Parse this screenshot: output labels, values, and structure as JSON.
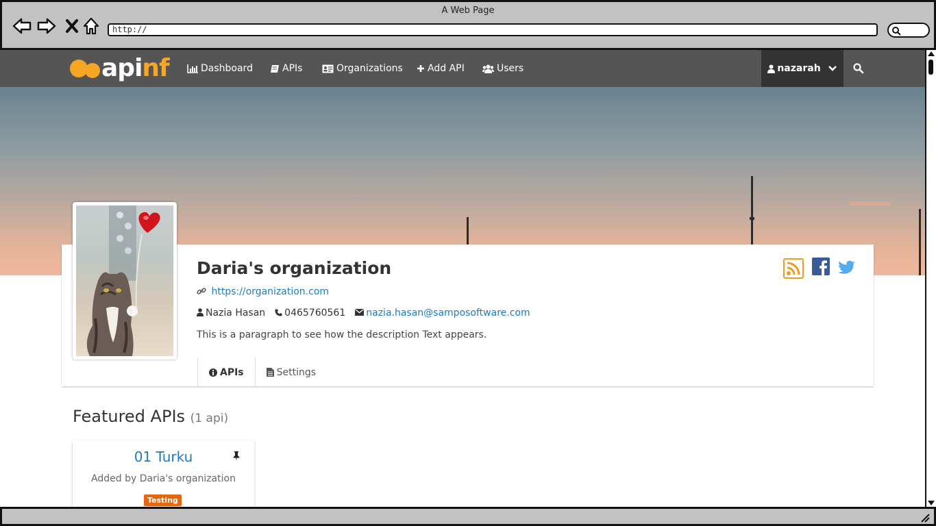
{
  "window": {
    "title": "A Web Page",
    "url": "http://"
  },
  "navbar": {
    "brand": {
      "api": "api",
      "nf": "nf"
    },
    "items": [
      {
        "label": "Dashboard",
        "icon": "bar-chart-icon"
      },
      {
        "label": "APIs",
        "icon": "book-icon"
      },
      {
        "label": "Organizations",
        "icon": "id-card-icon"
      },
      {
        "label": "Add API",
        "icon": "plus-icon"
      },
      {
        "label": "Users",
        "icon": "users-icon"
      }
    ],
    "user": "nazarah"
  },
  "organization": {
    "name": "Daria's organization",
    "url": "https://organization.com",
    "contact_name": "Nazia Hasan",
    "phone": "0465760561",
    "email": "nazia.hasan@samposoftware.com",
    "description": "This is a paragraph to see how the description Text appears."
  },
  "tabs": [
    {
      "label": "APIs",
      "icon": "info-icon",
      "active": true
    },
    {
      "label": "Settings",
      "icon": "document-icon",
      "active": false
    }
  ],
  "featured": {
    "title": "Featured APIs",
    "count": "(1 api)",
    "apis": [
      {
        "name": "01 Turku",
        "added_by": "Added by Daria's organization",
        "badge": "Testing"
      }
    ]
  },
  "colors": {
    "accent": "#f5a623",
    "link": "#1a7bc4",
    "badge": "#e3670f",
    "navbar": "#555555"
  }
}
